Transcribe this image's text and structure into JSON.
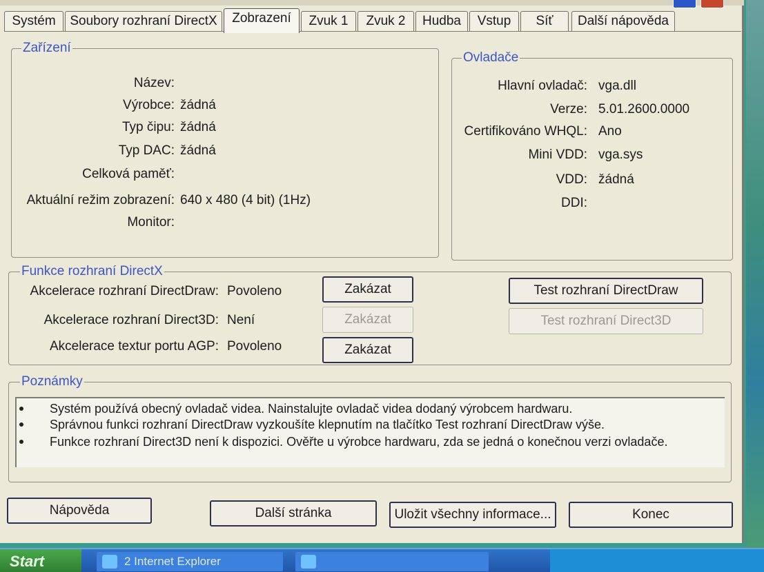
{
  "tabs": [
    {
      "label": "Systém"
    },
    {
      "label": "Soubory rozhraní DirectX"
    },
    {
      "label": "Zobrazení",
      "active": true
    },
    {
      "label": "Zvuk 1"
    },
    {
      "label": "Zvuk 2"
    },
    {
      "label": "Hudba"
    },
    {
      "label": "Vstup"
    },
    {
      "label": "Síť"
    },
    {
      "label": "Další nápověda"
    }
  ],
  "device": {
    "title": "Zařízení",
    "rows": [
      {
        "label": "Název:",
        "value": ""
      },
      {
        "label": "Výrobce:",
        "value": "žádná"
      },
      {
        "label": "Typ čipu:",
        "value": "žádná"
      },
      {
        "label": "Typ DAC:",
        "value": "žádná"
      },
      {
        "label": "Celková paměť:",
        "value": ""
      },
      {
        "label": "Aktuální režim zobrazení:",
        "value": "640 x 480 (4 bit) (1Hz)"
      },
      {
        "label": "Monitor:",
        "value": ""
      }
    ]
  },
  "drivers": {
    "title": "Ovladače",
    "rows": [
      {
        "label": "Hlavní ovladač:",
        "value": "vga.dll"
      },
      {
        "label": "Verze:",
        "value": "5.01.2600.0000"
      },
      {
        "label": "Certifikováno WHQL:",
        "value": "Ano"
      },
      {
        "label": "Mini VDD:",
        "value": "vga.sys"
      },
      {
        "label": "VDD:",
        "value": "žádná"
      },
      {
        "label": "DDI:",
        "value": ""
      }
    ]
  },
  "directx": {
    "title": "Funkce rozhraní DirectX",
    "rows": [
      {
        "label": "Akcelerace rozhraní DirectDraw:",
        "value": "Povoleno",
        "button": "Zakázat",
        "enabled": true
      },
      {
        "label": "Akcelerace rozhraní Direct3D:",
        "value": "Není",
        "button": "Zakázat",
        "enabled": false
      },
      {
        "label": "Akcelerace textur portu AGP:",
        "value": "Povoleno",
        "button": "Zakázat",
        "enabled": true
      }
    ],
    "test_directdraw": "Test rozhraní DirectDraw",
    "test_direct3d": "Test rozhraní Direct3D"
  },
  "notes": {
    "title": "Poznámky",
    "items": [
      "Systém používá obecný ovladač videa. Nainstalujte ovladač videa dodaný výrobcem hardwaru.",
      "Správnou funkci rozhraní DirectDraw vyzkoušíte klepnutím na tlačítko Test rozhraní DirectDraw výše.",
      "Funkce rozhraní Direct3D není k dispozici. Ověřte u výrobce hardwaru, zda se jedná o konečnou verzi ovladače."
    ]
  },
  "footer": {
    "help": "Nápověda",
    "next_page": "Další stránka",
    "save_all": "Uložit všechny informace...",
    "exit": "Konec"
  },
  "taskbar": {
    "start": "Start",
    "task1": "2 Internet Explorer"
  }
}
